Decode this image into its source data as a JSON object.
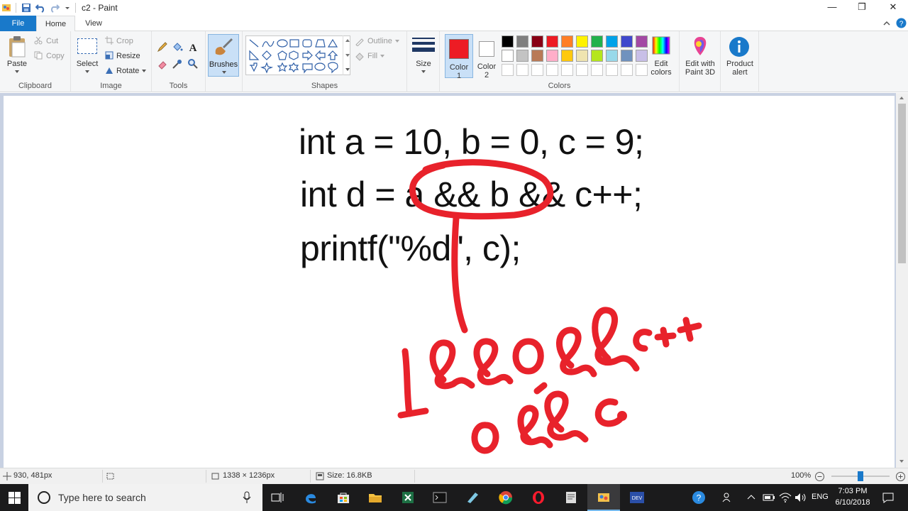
{
  "window": {
    "title": "c2 - Paint"
  },
  "window_controls": {
    "minimize": "—",
    "maximize": "❐",
    "close": "✕"
  },
  "tabs": {
    "file": "File",
    "home": "Home",
    "view": "View"
  },
  "ribbon": {
    "clipboard": {
      "paste": "Paste",
      "cut": "Cut",
      "copy": "Copy",
      "label": "Clipboard"
    },
    "image": {
      "select": "Select",
      "crop": "Crop",
      "resize": "Resize",
      "rotate": "Rotate",
      "label": "Image"
    },
    "tools": {
      "label": "Tools"
    },
    "brushes": {
      "label": "Brushes"
    },
    "shapes": {
      "outline": "Outline",
      "fill": "Fill",
      "label": "Shapes"
    },
    "size": {
      "label": "Size"
    },
    "colors": {
      "color1": "Color",
      "color1_num": "1",
      "color2": "Color",
      "color2_num": "2",
      "edit_colors_1": "Edit",
      "edit_colors_2": "colors",
      "label": "Colors",
      "color1_value": "#ed1c24",
      "color2_value": "#ffffff",
      "palette_row1": [
        "#000000",
        "#7f7f7f",
        "#880015",
        "#ed1c24",
        "#ff7f27",
        "#fff200",
        "#22b14c",
        "#00a2e8",
        "#3f48cc",
        "#a349a4"
      ],
      "palette_row2": [
        "#ffffff",
        "#c3c3c3",
        "#b97a57",
        "#ffaec9",
        "#ffc90e",
        "#efe4b0",
        "#b5e61d",
        "#99d9ea",
        "#7092be",
        "#c8bfe7"
      ]
    },
    "paint3d": {
      "line1": "Edit with",
      "line2": "Paint 3D"
    },
    "product_alert": {
      "line1": "Product",
      "line2": "alert"
    }
  },
  "canvas": {
    "code_line1": "int a = 10, b = 0, c = 9;",
    "code_line2": "int d = a && b && c++;",
    "code_line3": "printf(\"%d\", c);",
    "ink_color": "#e8222b"
  },
  "status": {
    "cursor_pos": "930, 481px",
    "canvas_size": "1338 × 1236px",
    "file_size": "Size: 16.8KB",
    "zoom": "100%"
  },
  "taskbar": {
    "search_placeholder": "Type here to search",
    "language": "ENG",
    "time": "7:03 PM",
    "date": "6/10/2018"
  }
}
